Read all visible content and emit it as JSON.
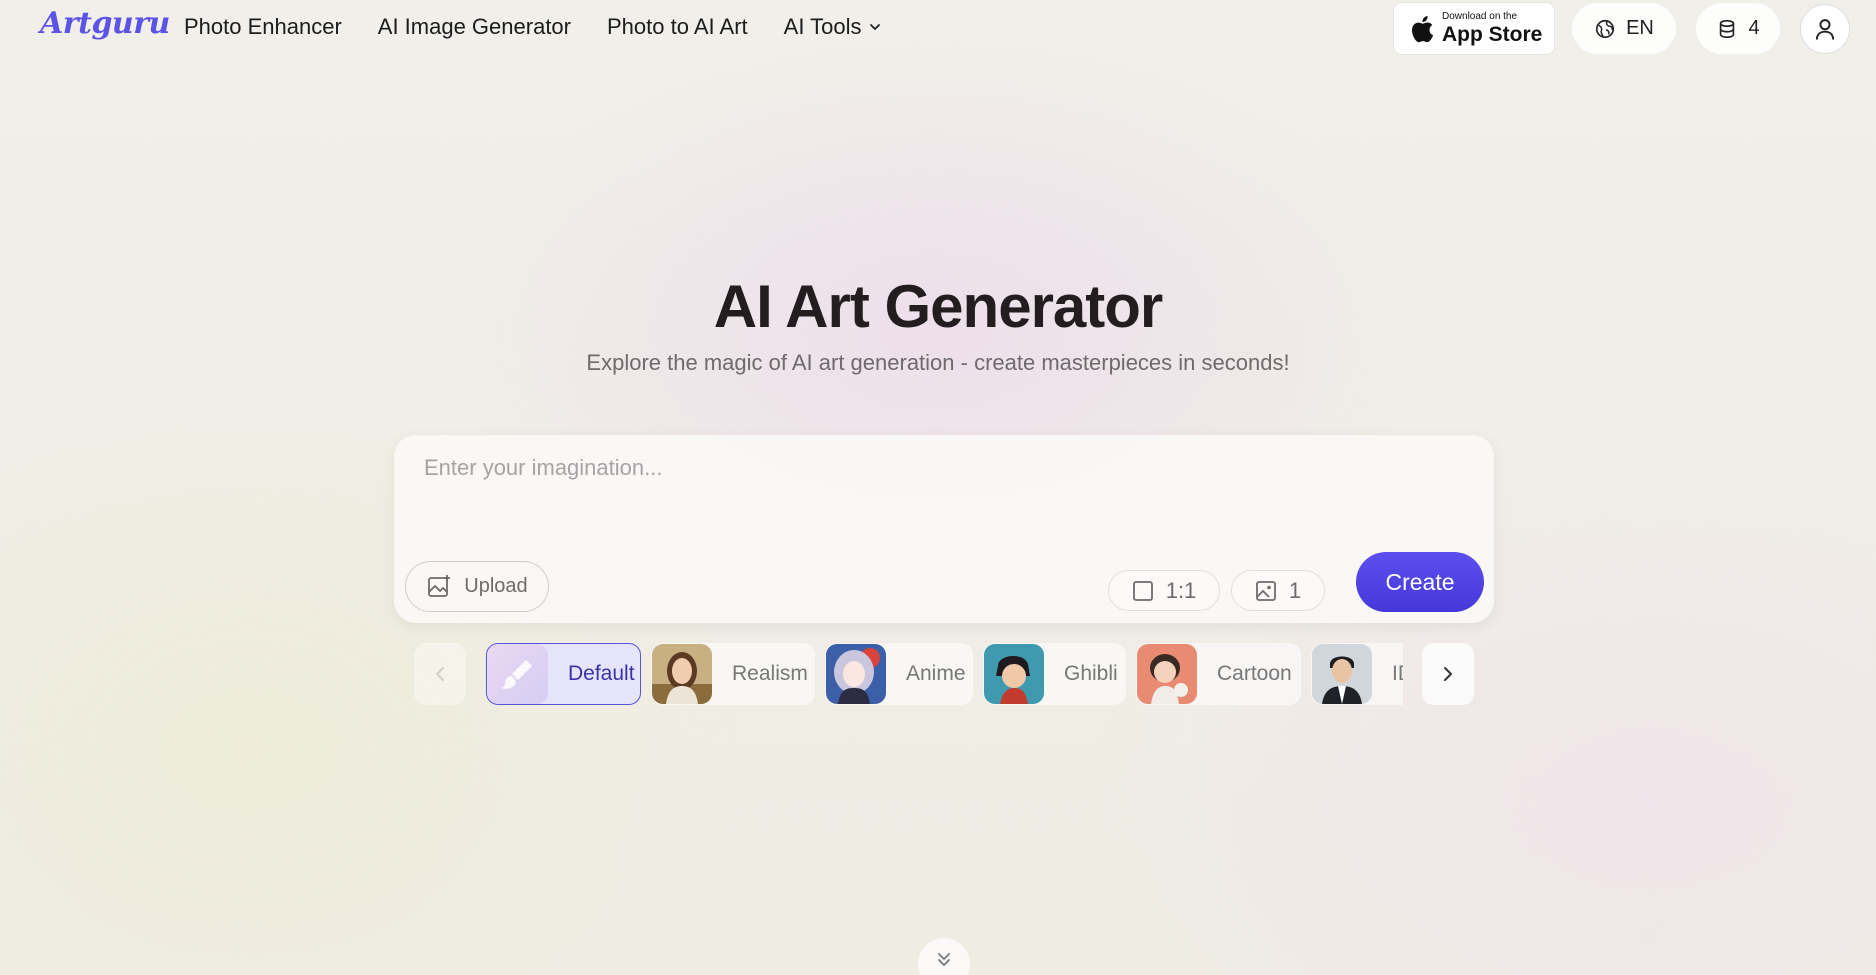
{
  "header": {
    "logo": "Artguru",
    "nav": [
      {
        "label": "Photo Enhancer"
      },
      {
        "label": "AI Image Generator"
      },
      {
        "label": "Photo to AI Art"
      },
      {
        "label": "AI Tools",
        "has_dropdown": true
      }
    ],
    "app_store": {
      "small": "Download on the",
      "big": "App Store"
    },
    "language": "EN",
    "credits": "4"
  },
  "hero": {
    "title": "AI Art Generator",
    "subtitle": "Explore the magic of AI art generation - create masterpieces in seconds!"
  },
  "prompt": {
    "placeholder": "Enter your imagination...",
    "value": "",
    "upload_label": "Upload",
    "ratio": "1:1",
    "image_count": "1",
    "create_label": "Create"
  },
  "styles": [
    {
      "label": "Default",
      "active": true
    },
    {
      "label": "Realism",
      "active": false
    },
    {
      "label": "Anime",
      "active": false
    },
    {
      "label": "Ghibli",
      "active": false
    },
    {
      "label": "Cartoon",
      "active": false
    },
    {
      "label": "ID Photo",
      "active": false
    }
  ],
  "colors": {
    "accent": "#4f46e5",
    "logo": "#5b52e6",
    "title": "#231d1f",
    "subtitle": "#6f6a6c"
  }
}
